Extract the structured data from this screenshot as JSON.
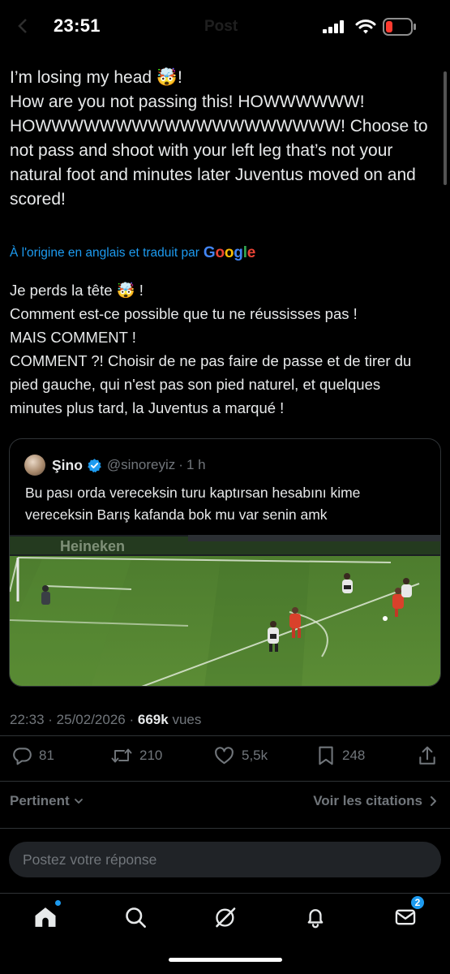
{
  "status_bar": {
    "time": "23:51",
    "header_title": "Post"
  },
  "tweet": {
    "text": "I’m losing my head 🤯!\nHow are you not passing this! HOWWWWWW!\nHOWWWWWWWWWWWWWWWWWWW! Choose to not pass and shoot with your left leg that’s not your natural foot and minutes later Juventus moved on and scored!",
    "translation_note": "À l'origine en anglais et traduit par",
    "translation_provider": "Google",
    "translated_text": "Je perds la tête 🤯 !\nComment est-ce possible que tu ne réussisses pas !\nMAIS COMMENT !\nCOMMENT ?! Choisir de ne pas faire de passe et de tirer du pied gauche, qui n'est pas son pied naturel, et quelques minutes plus tard, la Juventus a marqué !",
    "time": "22:33",
    "date": "25/02/2026",
    "views": "669k",
    "views_label": "vues"
  },
  "quote": {
    "name": "Şino",
    "handle": "@sinoreyiz",
    "age": "1 h",
    "text": "Bu pası orda vereceksin turu kaptırsan hesabını kime vereceksin Barış kafanda bok mu var senin amk",
    "media_ad_text": "Heineken"
  },
  "actions": {
    "replies": "81",
    "reposts": "210",
    "likes": "5,5k",
    "bookmarks": "248"
  },
  "sort": {
    "label": "Pertinent",
    "quotes_label": "Voir les citations"
  },
  "reply": {
    "placeholder": "Postez votre réponse"
  },
  "tabs": {
    "messages_badge": "2"
  },
  "colors": {
    "accent": "#1d9bf0",
    "text": "#e7e9ea",
    "muted": "#71767b",
    "border": "#2f3336",
    "background": "#000000"
  },
  "icons": [
    "back-icon",
    "signal-icon",
    "wifi-icon",
    "battery-icon",
    "verified-icon",
    "reply-icon",
    "repost-icon",
    "like-icon",
    "bookmark-icon",
    "share-icon",
    "chevron-down-icon",
    "chevron-right-icon",
    "home-icon",
    "search-icon",
    "grok-icon",
    "notifications-icon",
    "messages-icon"
  ]
}
